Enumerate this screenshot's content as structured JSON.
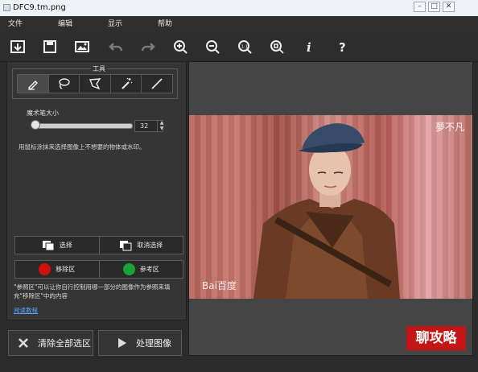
{
  "window": {
    "title": "DFC9.tm.png"
  },
  "menu": [
    "文件",
    "编辑",
    "显示",
    "帮助"
  ],
  "toolbar": {
    "buttons": [
      {
        "name": "open-icon"
      },
      {
        "name": "save-icon"
      },
      {
        "name": "image-icon"
      },
      {
        "name": "undo-icon"
      },
      {
        "name": "redo-icon"
      },
      {
        "name": "zoom-in-icon"
      },
      {
        "name": "zoom-out-icon"
      },
      {
        "name": "actual-size-icon"
      },
      {
        "name": "fit-icon"
      },
      {
        "name": "info-icon"
      },
      {
        "name": "help-icon"
      }
    ]
  },
  "tools_panel": {
    "group_title": "工具",
    "tools": [
      "brush-icon",
      "lasso-icon",
      "polygon-lasso-icon",
      "magic-wand-icon",
      "line-icon"
    ],
    "brush_size_label": "魔术笔大小",
    "brush_size_value": "32",
    "brush_size_level": 0.1,
    "hint": "用鼠标涂抹来选择图像上不想要的物体或水印。",
    "select_button": "选择",
    "deselect_button": "取消选择",
    "remove_area": {
      "label": "移除区",
      "color": "#d10f0f"
    },
    "reference_area": {
      "label": "参考区",
      "color": "#19a338"
    },
    "note": "\"参照区\"可以让你自行控制用哪一部分的图像作为参照来填充\"移除区\"中的内容",
    "link_text": "阅读教程"
  },
  "bottom_buttons": {
    "clear_all": "清除全部选区",
    "process": "处理图像"
  },
  "canvas": {
    "watermark_text": "Bai百度",
    "stamp_text": "夢不凡",
    "corner_logo_text": "聊攻略"
  }
}
